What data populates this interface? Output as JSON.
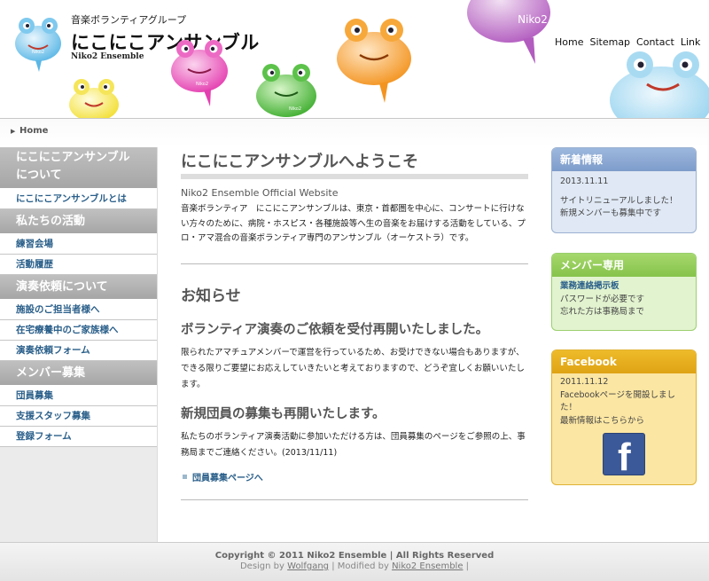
{
  "header": {
    "subtitle": "音楽ボランティアグループ",
    "title": "にこにこアンサンブル",
    "title_en": "Niko2 Ensemble",
    "balloon_labels": [
      "Niko2",
      "Niko2",
      "Niko2",
      "Niko2"
    ],
    "nav": [
      "Home",
      "Sitemap",
      "Contact",
      "Link"
    ]
  },
  "breadcrumb": {
    "home": "Home"
  },
  "sidebar": {
    "sections": [
      {
        "heading": "にこにこアンサンブルについて",
        "items": [
          "にこにこアンサンブルとは"
        ]
      },
      {
        "heading": "私たちの活動",
        "items": [
          "練習会場",
          "活動履歴"
        ]
      },
      {
        "heading": "演奏依頼について",
        "items": [
          "施設のご担当者様へ",
          "在宅療養中のご家族様へ",
          "演奏依頼フォーム"
        ]
      },
      {
        "heading": "メンバー募集",
        "items": [
          "団員募集",
          "支援スタッフ募集",
          "登録フォーム"
        ]
      }
    ]
  },
  "main": {
    "welcome_title": "にこにこアンサンブルへようこそ",
    "tagline": "Niko2 Ensemble Official Website",
    "intro": "音楽ボランティア　にこにこアンサンブルは、東京・首都圏を中心に、コンサートに行けない方々のために、病院・ホスピス・各種施設等へ生の音楽をお届けする活動をしている、プロ・アマ混合の音楽ボランティア専門のアンサンブル（オーケストラ）です。",
    "news_title": "お知らせ",
    "news": [
      {
        "heading": "ボランティア演奏のご依頼を受付再開いたしました。",
        "body": "限られたアマチュアメンバーで運営を行っているため、お受けできない場合もありますが、できる限りご要望にお応えしていきたいと考えておりますので、どうぞ宜しくお願いいたします。"
      },
      {
        "heading": "新規団員の募集も再開いたします。",
        "body": "私たちのボランティア演奏活動に参加いただける方は、団員募集のページをご参照の上、事務局までご連絡ください。(2013/11/11)"
      }
    ],
    "recruit_link": "団員募集ページへ"
  },
  "right": {
    "news_box": {
      "heading": "新着情報",
      "date": "2013.11.11",
      "line1": "サイトリニューアルしました！",
      "line2": "新規メンバーも募集中です"
    },
    "members_box": {
      "heading": "メンバー専用",
      "link": "業務連絡掲示板",
      "line1": "パスワードが必要です",
      "line2": "忘れた方は事務局まで"
    },
    "facebook_box": {
      "heading": "Facebook",
      "date": "2011.11.12",
      "line1": "Facebookページを開設しました！",
      "line2": "最新情報はこちらから",
      "logo_icon": "facebook-logo-icon"
    }
  },
  "footer": {
    "copyright": "Copyright © 2011 Niko2 Ensemble | All Rights Reserved",
    "design_by": "Design by",
    "designer": "Wolfgang",
    "modified_by": "| Modified by",
    "modifier": "Niko2 Ensemble",
    "trail": "|"
  },
  "colors": {
    "link": "#2a5f8a",
    "news_box": "#7e9ccb",
    "members_box": "#86c34b",
    "facebook_box": "#dfa315",
    "facebook_brand": "#3b5998"
  }
}
